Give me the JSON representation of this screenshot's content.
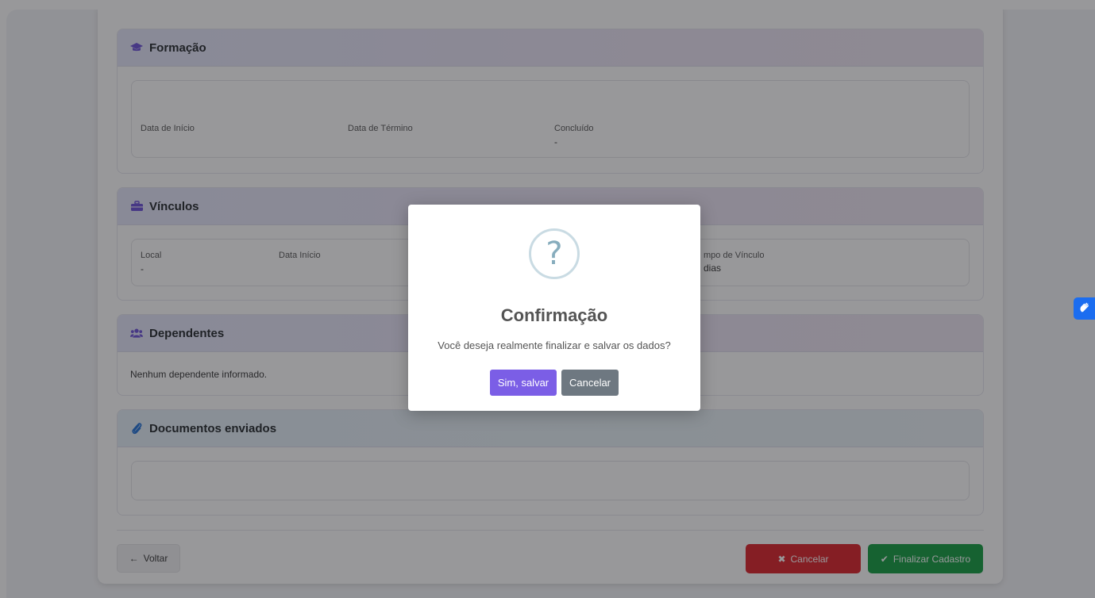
{
  "sections": {
    "formacao": {
      "title": "Formação",
      "fields": [
        {
          "label": "Data de Início",
          "value": ""
        },
        {
          "label": "Data de Término",
          "value": ""
        },
        {
          "label": "Concluído",
          "value": "-"
        }
      ]
    },
    "vinculos": {
      "title": "Vínculos",
      "fields": [
        {
          "label": "Local",
          "value": "-"
        },
        {
          "label": "Data Início",
          "value": ""
        },
        {
          "label": "mpo de Vínculo",
          "value": "dias"
        }
      ]
    },
    "dependentes": {
      "title": "Dependentes",
      "empty_text": "Nenhum dependente informado."
    },
    "documentos": {
      "title": "Documentos enviados"
    }
  },
  "footer": {
    "back_label": "Voltar",
    "cancel_label": "Cancelar",
    "finish_label": "Finalizar Cadastro"
  },
  "modal": {
    "icon": "?",
    "title": "Confirmação",
    "message": "Você deseja realmente finalizar e salvar os dados?",
    "confirm_label": "Sim, salvar",
    "deny_label": "Cancelar"
  },
  "colors": {
    "danger": "#dc1f26",
    "success": "#0f9c3d",
    "confirm": "#7b5ee6",
    "deny": "#6e7881",
    "accessibility": "#1b6df0"
  },
  "icons": {
    "formacao": "graduation-cap-icon",
    "vinculos": "briefcase-icon",
    "dependentes": "users-icon",
    "documentos": "paperclip-icon",
    "back": "arrow-left-icon",
    "cancel": "x-icon",
    "finish": "check-icon",
    "accessibility": "sign-language-hand-icon",
    "modal": "question-circle-icon"
  }
}
